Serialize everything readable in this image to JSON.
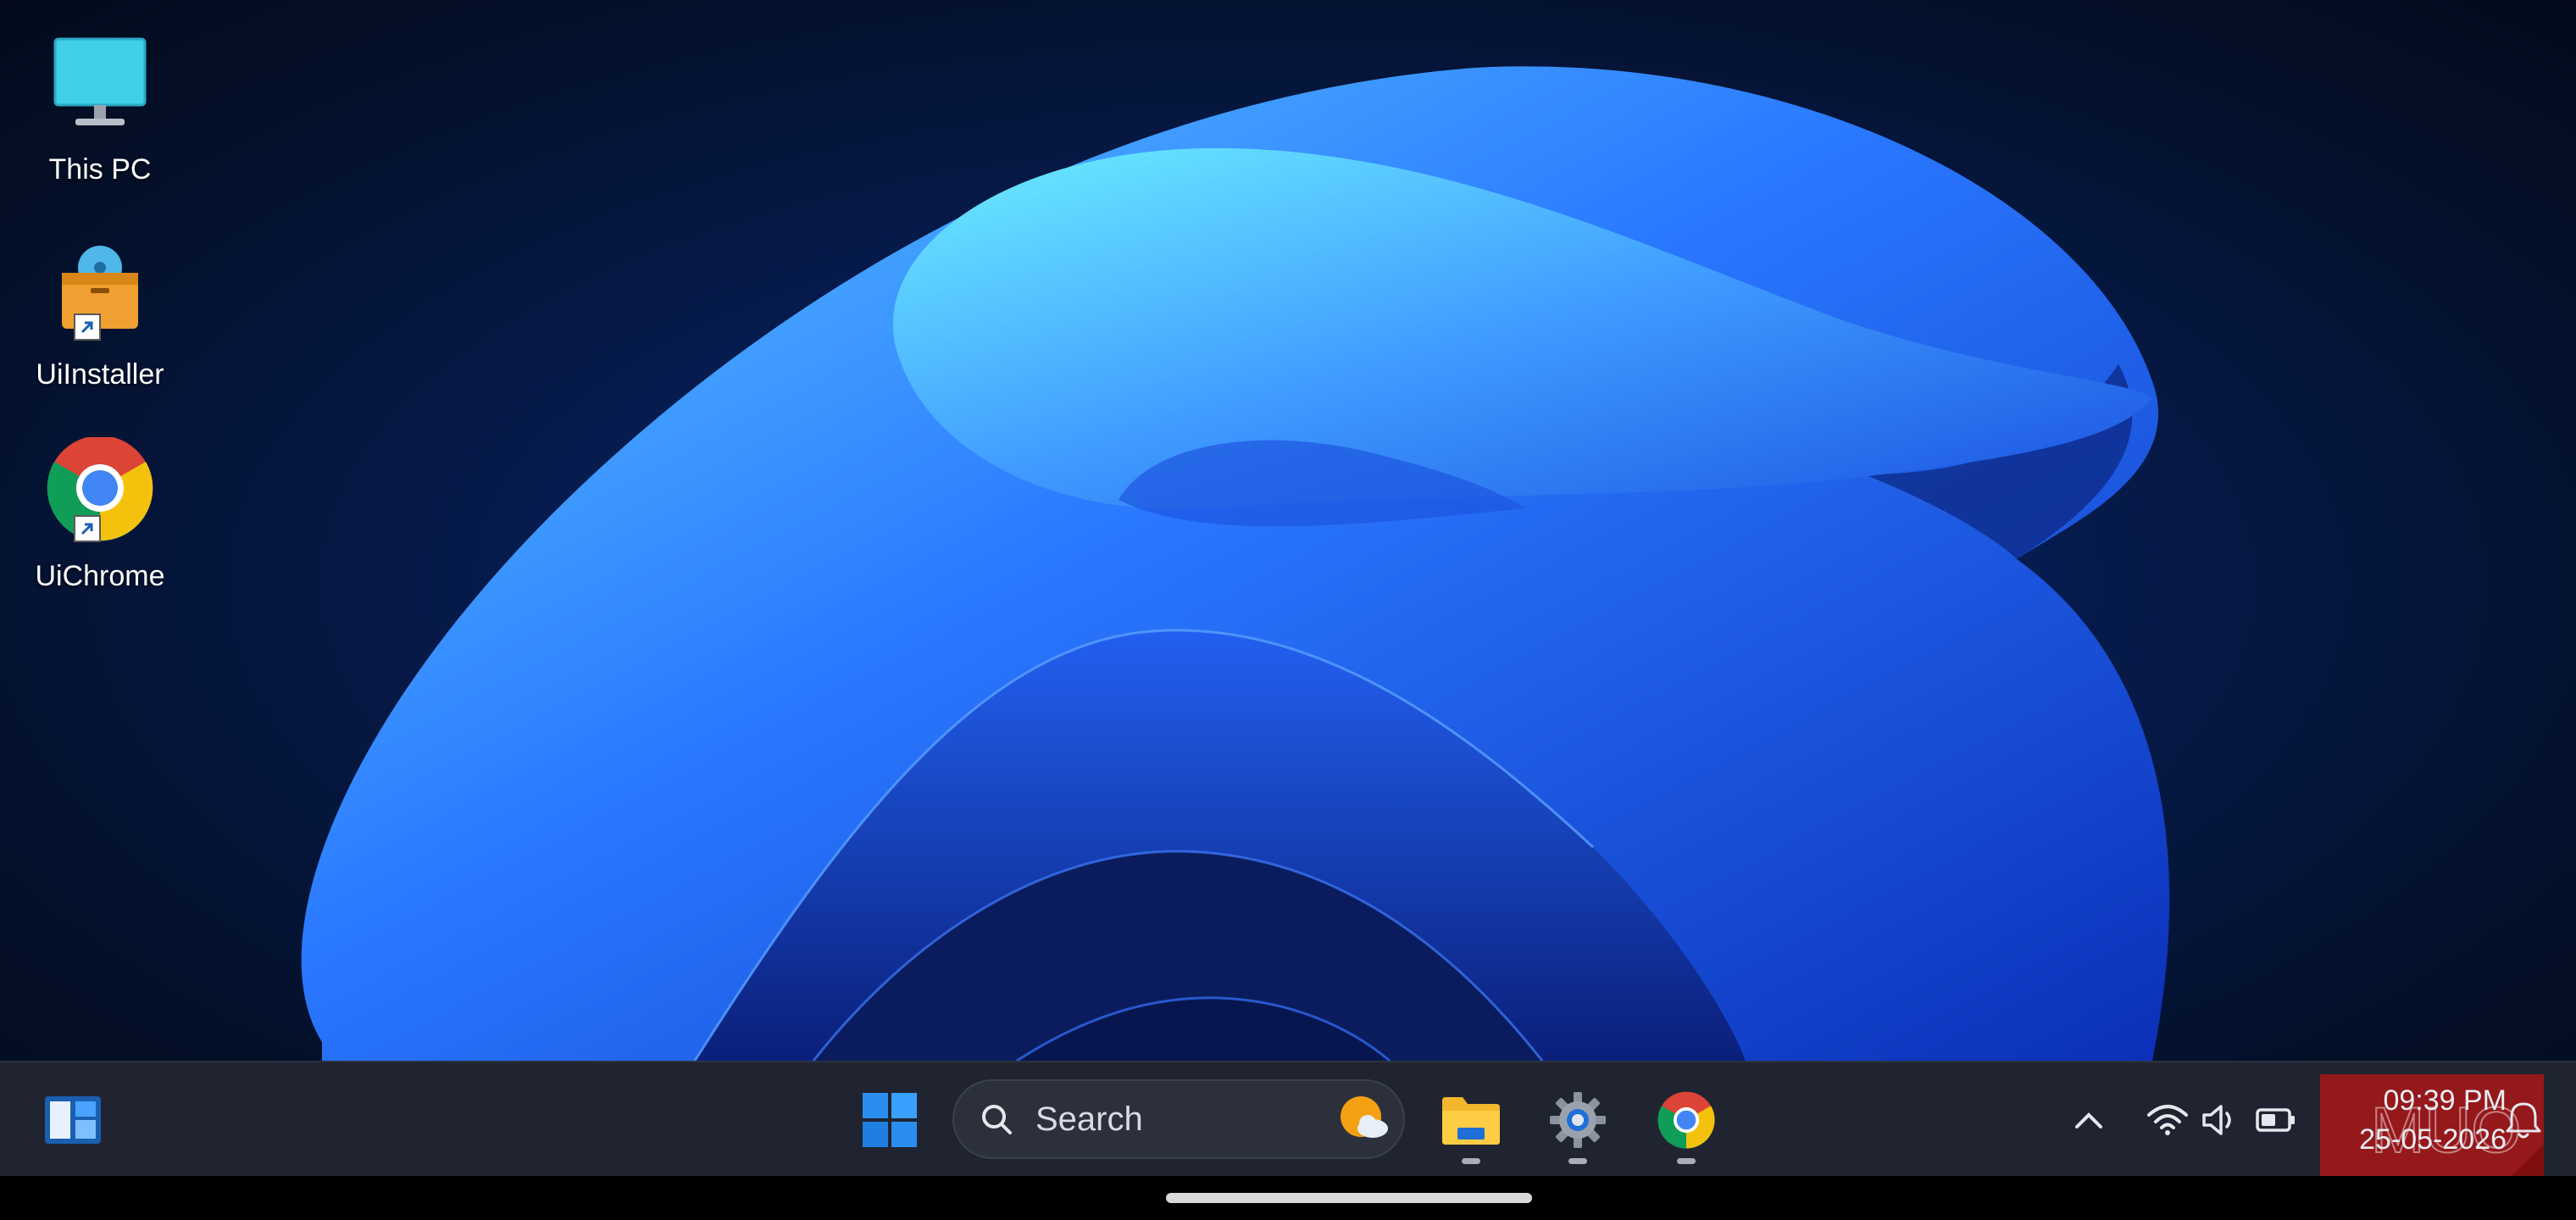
{
  "desktop": {
    "icons": [
      {
        "label": "This PC",
        "icon": "monitor-icon"
      },
      {
        "label": "UiInstaller",
        "icon": "installer-icon",
        "shortcut": true
      },
      {
        "label": "UiChrome",
        "icon": "chrome-icon",
        "shortcut": true
      }
    ]
  },
  "taskbar": {
    "widgets_icon": "widgets-icon",
    "start_icon": "windows-logo-icon",
    "search": {
      "placeholder": "Search",
      "weather_icon": "weather-sun-cloud-icon"
    },
    "pinned": [
      {
        "name": "File Explorer",
        "icon": "folder-icon",
        "running": true
      },
      {
        "name": "Settings",
        "icon": "gear-icon",
        "running": true
      },
      {
        "name": "Chrome",
        "icon": "chrome-icon",
        "running": true
      }
    ],
    "tray": {
      "chevron_icon": "chevron-up-icon",
      "wifi_icon": "wifi-icon",
      "volume_icon": "speaker-icon",
      "battery_icon": "battery-icon",
      "time": "09:39 PM",
      "date": "25-05-2026",
      "notification_icon": "bell-icon"
    },
    "watermark": "MUO"
  },
  "colors": {
    "taskbar_bg": "#1f2430",
    "wallpaper_accent": "#2f6bff",
    "windows_blue": "#2a8ef0"
  }
}
